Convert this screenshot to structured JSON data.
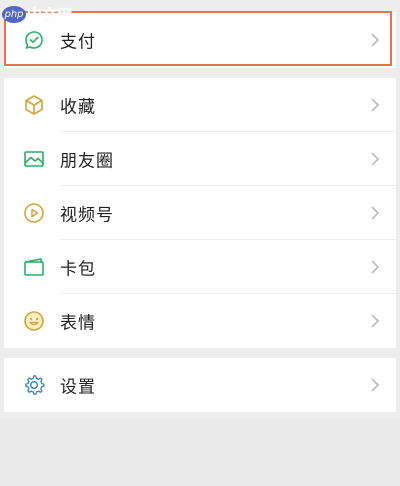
{
  "watermark": {
    "text": "中文网",
    "logo": "php"
  },
  "menu": {
    "pay": {
      "label": "支付",
      "icon": "pay-check-icon"
    },
    "items": [
      {
        "label": "收藏",
        "icon": "favorites-cube-icon"
      },
      {
        "label": "朋友圈",
        "icon": "moments-photo-icon"
      },
      {
        "label": "视频号",
        "icon": "channels-play-icon"
      },
      {
        "label": "卡包",
        "icon": "card-wallet-icon"
      },
      {
        "label": "表情",
        "icon": "sticker-smile-icon"
      }
    ],
    "settings": {
      "label": "设置",
      "icon": "settings-gear-icon"
    }
  },
  "colors": {
    "icon_green": "#2aae67",
    "icon_gold": "#d4a43a",
    "highlight_border": "#e8734a",
    "watermark_logo": "#5166c4"
  }
}
